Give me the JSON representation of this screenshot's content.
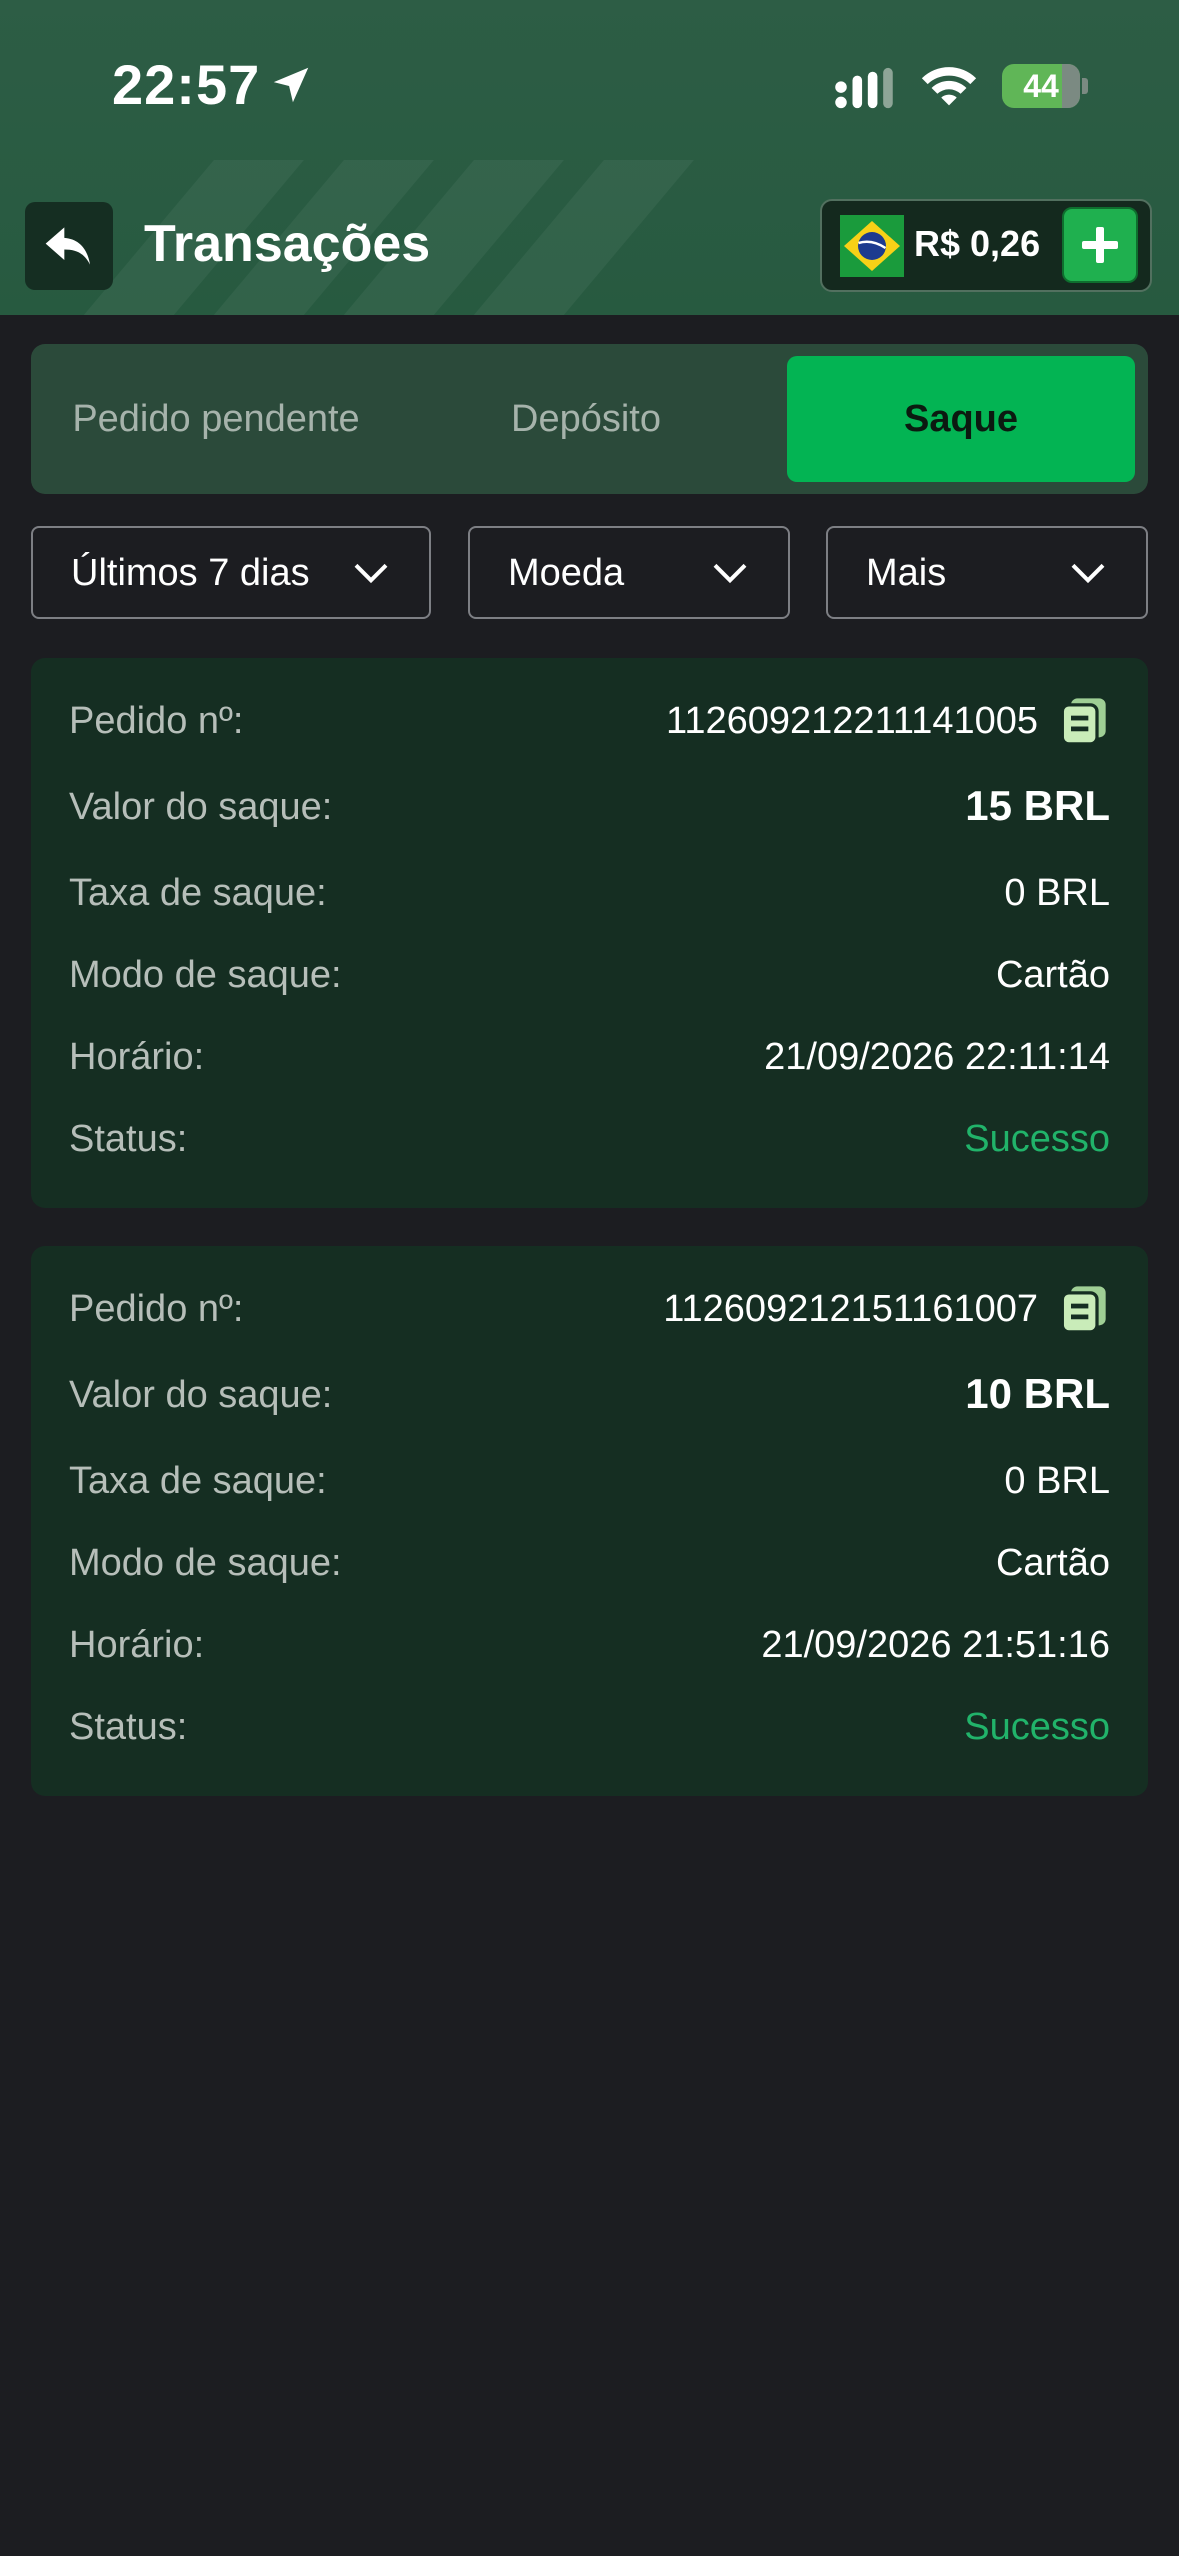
{
  "status_bar": {
    "time": "22:57",
    "battery": "44"
  },
  "header": {
    "title": "Transações",
    "balance": "R$ 0,26"
  },
  "tabs": [
    "Pedido pendente",
    "Depósito",
    "Saque"
  ],
  "active_tab": "Saque",
  "filters": [
    {
      "label": "Últimos 7 dias"
    },
    {
      "label": "Moeda"
    },
    {
      "label": "Mais"
    }
  ],
  "labels": {
    "order": "Pedido nº:",
    "amount": "Valor do saque:",
    "fee": "Taxa de saque:",
    "mode": "Modo de saque:",
    "time": "Horário:",
    "status": "Status:"
  },
  "transactions": [
    {
      "order_no": "112609212211141005",
      "amount": "15 BRL",
      "fee": "0 BRL",
      "mode": "Cartão",
      "time": "21/09/2026 22:11:14",
      "status": "Sucesso"
    },
    {
      "order_no": "112609212151161007",
      "amount": "10 BRL",
      "fee": "0 BRL",
      "mode": "Cartão",
      "time": "21/09/2026 21:51:16",
      "status": "Sucesso"
    }
  ],
  "colors": {
    "accent": "#03b453",
    "success": "#21b36a",
    "card": "#152e22",
    "background": "#1c1d21"
  }
}
